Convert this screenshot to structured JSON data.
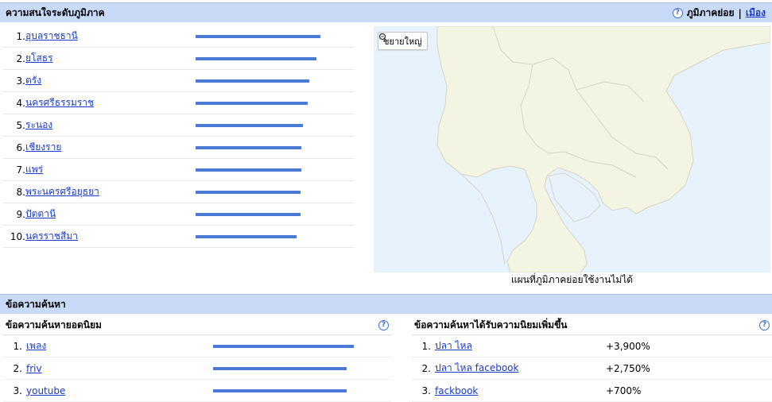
{
  "region": {
    "title": "ความสนใจระดับภูมิภาค",
    "subregion_label": "ภูมิภาคย่อย",
    "separator": "|",
    "city_link": "เมือง",
    "items": [
      {
        "rank": "1.",
        "label": "อุบลราชธานี",
        "value": 100
      },
      {
        "rank": "2.",
        "label": "ยโสธร",
        "value": 97
      },
      {
        "rank": "3.",
        "label": "ตรัง",
        "value": 91
      },
      {
        "rank": "4.",
        "label": "นครศรีธรรมราช",
        "value": 90
      },
      {
        "rank": "5.",
        "label": "ระนอง",
        "value": 86
      },
      {
        "rank": "6.",
        "label": "เชียงราย",
        "value": 85
      },
      {
        "rank": "7.",
        "label": "แพร่",
        "value": 85
      },
      {
        "rank": "8.",
        "label": "พระนครศรีอยุธยา",
        "value": 84
      },
      {
        "rank": "9.",
        "label": "ปัตตานี",
        "value": 84
      },
      {
        "rank": "10.",
        "label": "นครราชสีมา",
        "value": 81
      }
    ]
  },
  "map": {
    "zoom_label": "ขยายใหญ่",
    "caption": "แผนที่ภูมิภาคย่อยใช้งานไม่ได้",
    "colors": {
      "water": "#e8f2fc",
      "land": "#f4f4e2",
      "border": "#d6d6c4"
    }
  },
  "queries": {
    "title": "ข้อความค้นหา",
    "top": {
      "title": "ข้อความค้นหายอดนิยม",
      "items": [
        {
          "rank": "1.",
          "label": "เพลง",
          "value": 100
        },
        {
          "rank": "2.",
          "label": "friv",
          "value": 95
        },
        {
          "rank": "3.",
          "label": "youtube",
          "value": 95
        }
      ]
    },
    "rising": {
      "title": "ข้อความค้นหาได้รับความนิยมเพิ่มขึ้น",
      "items": [
        {
          "rank": "1.",
          "label": "ปลา ไหล",
          "change": "+3,900%"
        },
        {
          "rank": "2.",
          "label": "ปลา ไหล facebook",
          "change": "+2,750%"
        },
        {
          "rank": "3.",
          "label": "fackbook",
          "change": "+700%"
        }
      ]
    }
  },
  "colors": {
    "header_bg": "#c9daf8",
    "bar": "#4a79d6",
    "link": "#1a3cc8"
  }
}
